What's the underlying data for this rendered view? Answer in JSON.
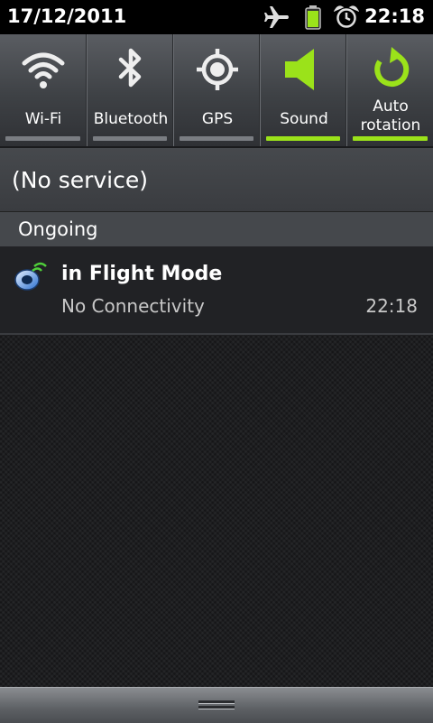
{
  "status_bar": {
    "date": "17/12/2011",
    "time": "22:18",
    "icons": [
      "airplane-icon",
      "battery-icon",
      "alarm-icon"
    ],
    "battery_color": "#9be21a"
  },
  "quick_settings": {
    "accent": "#9be21a",
    "tiles": [
      {
        "label": "Wi-Fi",
        "icon": "wifi-icon",
        "on": false
      },
      {
        "label": "Bluetooth",
        "icon": "bluetooth-icon",
        "on": false
      },
      {
        "label": "GPS",
        "icon": "gps-icon",
        "on": false
      },
      {
        "label": "Sound",
        "icon": "sound-icon",
        "on": true
      },
      {
        "label_line1": "Auto",
        "label_line2": "rotation",
        "icon": "auto-rotation-icon",
        "on": true
      }
    ]
  },
  "service": {
    "text": "(No service)"
  },
  "ongoing": {
    "header": "Ongoing",
    "notification": {
      "title": "in Flight Mode",
      "subtitle": "No Connectivity",
      "time": "22:18",
      "icon": "flight-mode-app-icon"
    }
  },
  "handle": {
    "icon": "grip-handle-icon"
  }
}
